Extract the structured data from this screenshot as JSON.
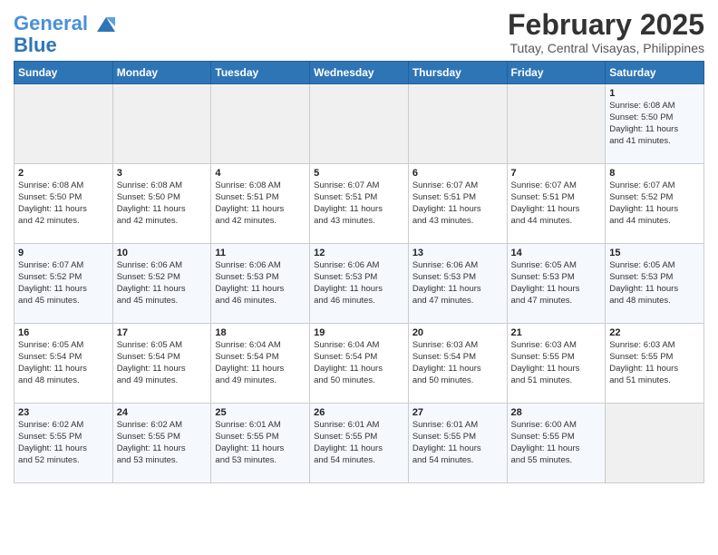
{
  "header": {
    "logo_line1": "General",
    "logo_line2": "Blue",
    "month": "February 2025",
    "location": "Tutay, Central Visayas, Philippines"
  },
  "weekdays": [
    "Sunday",
    "Monday",
    "Tuesday",
    "Wednesday",
    "Thursday",
    "Friday",
    "Saturday"
  ],
  "weeks": [
    [
      {
        "day": "",
        "info": ""
      },
      {
        "day": "",
        "info": ""
      },
      {
        "day": "",
        "info": ""
      },
      {
        "day": "",
        "info": ""
      },
      {
        "day": "",
        "info": ""
      },
      {
        "day": "",
        "info": ""
      },
      {
        "day": "1",
        "info": "Sunrise: 6:08 AM\nSunset: 5:50 PM\nDaylight: 11 hours\nand 41 minutes."
      }
    ],
    [
      {
        "day": "2",
        "info": "Sunrise: 6:08 AM\nSunset: 5:50 PM\nDaylight: 11 hours\nand 42 minutes."
      },
      {
        "day": "3",
        "info": "Sunrise: 6:08 AM\nSunset: 5:50 PM\nDaylight: 11 hours\nand 42 minutes."
      },
      {
        "day": "4",
        "info": "Sunrise: 6:08 AM\nSunset: 5:51 PM\nDaylight: 11 hours\nand 42 minutes."
      },
      {
        "day": "5",
        "info": "Sunrise: 6:07 AM\nSunset: 5:51 PM\nDaylight: 11 hours\nand 43 minutes."
      },
      {
        "day": "6",
        "info": "Sunrise: 6:07 AM\nSunset: 5:51 PM\nDaylight: 11 hours\nand 43 minutes."
      },
      {
        "day": "7",
        "info": "Sunrise: 6:07 AM\nSunset: 5:51 PM\nDaylight: 11 hours\nand 44 minutes."
      },
      {
        "day": "8",
        "info": "Sunrise: 6:07 AM\nSunset: 5:52 PM\nDaylight: 11 hours\nand 44 minutes."
      }
    ],
    [
      {
        "day": "9",
        "info": "Sunrise: 6:07 AM\nSunset: 5:52 PM\nDaylight: 11 hours\nand 45 minutes."
      },
      {
        "day": "10",
        "info": "Sunrise: 6:06 AM\nSunset: 5:52 PM\nDaylight: 11 hours\nand 45 minutes."
      },
      {
        "day": "11",
        "info": "Sunrise: 6:06 AM\nSunset: 5:53 PM\nDaylight: 11 hours\nand 46 minutes."
      },
      {
        "day": "12",
        "info": "Sunrise: 6:06 AM\nSunset: 5:53 PM\nDaylight: 11 hours\nand 46 minutes."
      },
      {
        "day": "13",
        "info": "Sunrise: 6:06 AM\nSunset: 5:53 PM\nDaylight: 11 hours\nand 47 minutes."
      },
      {
        "day": "14",
        "info": "Sunrise: 6:05 AM\nSunset: 5:53 PM\nDaylight: 11 hours\nand 47 minutes."
      },
      {
        "day": "15",
        "info": "Sunrise: 6:05 AM\nSunset: 5:53 PM\nDaylight: 11 hours\nand 48 minutes."
      }
    ],
    [
      {
        "day": "16",
        "info": "Sunrise: 6:05 AM\nSunset: 5:54 PM\nDaylight: 11 hours\nand 48 minutes."
      },
      {
        "day": "17",
        "info": "Sunrise: 6:05 AM\nSunset: 5:54 PM\nDaylight: 11 hours\nand 49 minutes."
      },
      {
        "day": "18",
        "info": "Sunrise: 6:04 AM\nSunset: 5:54 PM\nDaylight: 11 hours\nand 49 minutes."
      },
      {
        "day": "19",
        "info": "Sunrise: 6:04 AM\nSunset: 5:54 PM\nDaylight: 11 hours\nand 50 minutes."
      },
      {
        "day": "20",
        "info": "Sunrise: 6:03 AM\nSunset: 5:54 PM\nDaylight: 11 hours\nand 50 minutes."
      },
      {
        "day": "21",
        "info": "Sunrise: 6:03 AM\nSunset: 5:55 PM\nDaylight: 11 hours\nand 51 minutes."
      },
      {
        "day": "22",
        "info": "Sunrise: 6:03 AM\nSunset: 5:55 PM\nDaylight: 11 hours\nand 51 minutes."
      }
    ],
    [
      {
        "day": "23",
        "info": "Sunrise: 6:02 AM\nSunset: 5:55 PM\nDaylight: 11 hours\nand 52 minutes."
      },
      {
        "day": "24",
        "info": "Sunrise: 6:02 AM\nSunset: 5:55 PM\nDaylight: 11 hours\nand 53 minutes."
      },
      {
        "day": "25",
        "info": "Sunrise: 6:01 AM\nSunset: 5:55 PM\nDaylight: 11 hours\nand 53 minutes."
      },
      {
        "day": "26",
        "info": "Sunrise: 6:01 AM\nSunset: 5:55 PM\nDaylight: 11 hours\nand 54 minutes."
      },
      {
        "day": "27",
        "info": "Sunrise: 6:01 AM\nSunset: 5:55 PM\nDaylight: 11 hours\nand 54 minutes."
      },
      {
        "day": "28",
        "info": "Sunrise: 6:00 AM\nSunset: 5:55 PM\nDaylight: 11 hours\nand 55 minutes."
      },
      {
        "day": "",
        "info": ""
      }
    ]
  ]
}
